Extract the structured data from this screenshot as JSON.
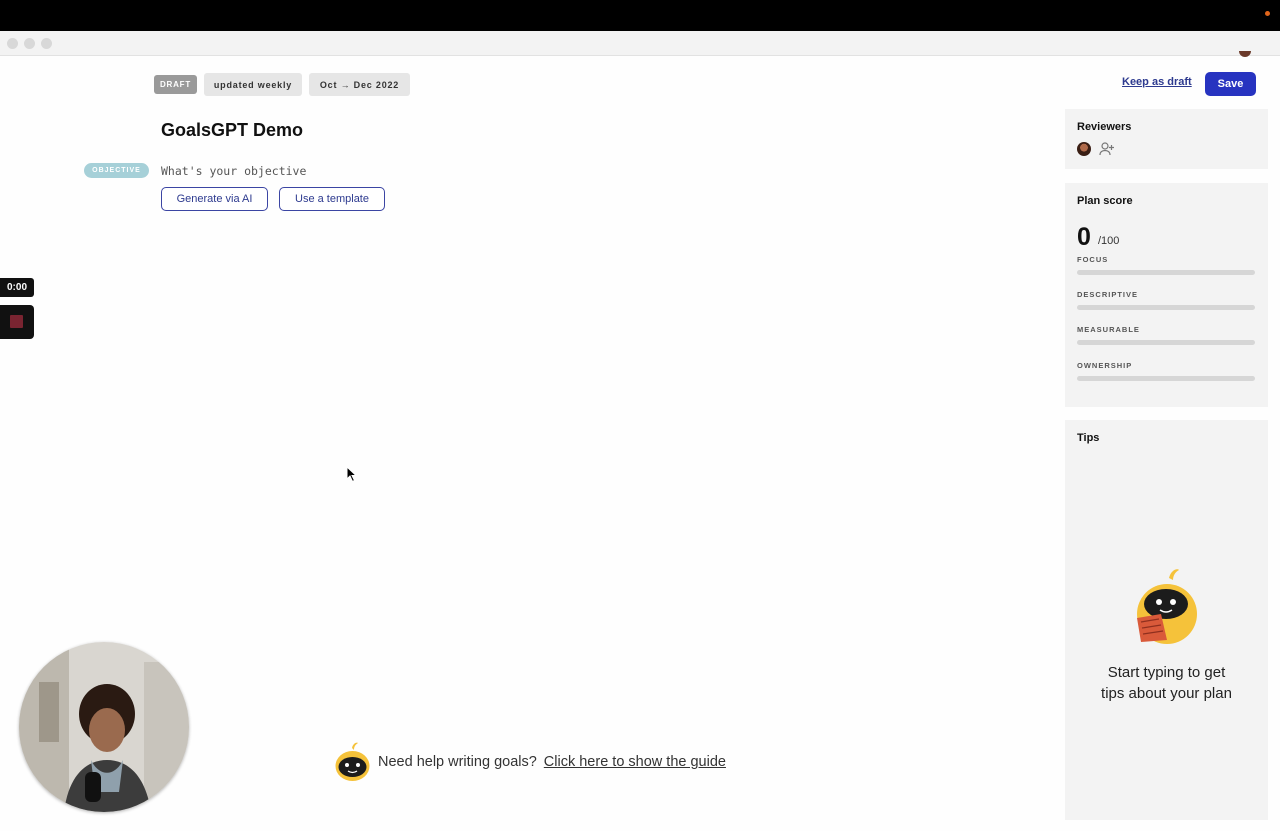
{
  "header": {
    "status_badge": "DRAFT",
    "cadence": "updated weekly",
    "period": "Oct → Dec 2022",
    "keep_draft": "Keep as draft",
    "save": "Save"
  },
  "document": {
    "title": "GoalsGPT Demo",
    "objective_badge": "OBJECTIVE",
    "objective_placeholder": "What's your objective",
    "generate_ai": "Generate via AI",
    "use_template": "Use a template"
  },
  "sidebar": {
    "reviewers": {
      "title": "Reviewers"
    },
    "plan_score": {
      "title": "Plan score",
      "score": "0",
      "max": "/100",
      "metrics": [
        {
          "label": "FOCUS",
          "value": 0
        },
        {
          "label": "DESCRIPTIVE",
          "value": 0
        },
        {
          "label": "MEASURABLE",
          "value": 0
        },
        {
          "label": "OWNERSHIP",
          "value": 0
        }
      ]
    },
    "tips": {
      "title": "Tips",
      "message_line1": "Start typing to get",
      "message_line2": "tips about your plan"
    }
  },
  "helper": {
    "text": "Need help writing goals?",
    "link": "Click here to show the guide"
  },
  "recorder": {
    "time": "0:00"
  },
  "colors": {
    "accent": "#2733c0",
    "link": "#2d3a8f",
    "objective_badge": "#a6d0d8",
    "panel_bg": "#f3f3f3",
    "mascot": "#f5c23a"
  }
}
